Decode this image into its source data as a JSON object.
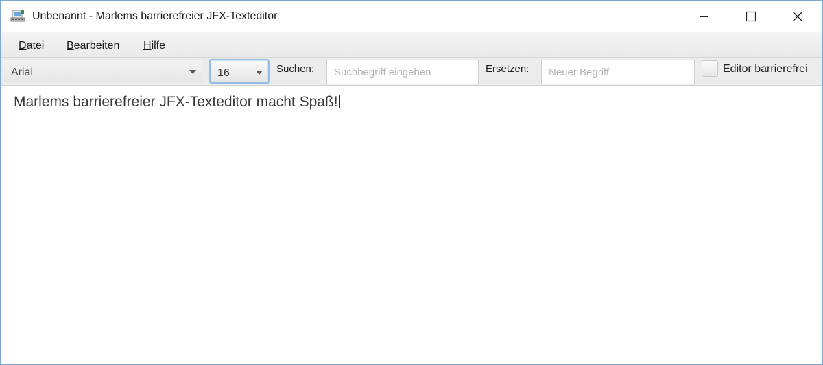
{
  "window": {
    "title": "Unbenannt - Marlems barrierefreier JFX-Texteditor",
    "border_color": "#7aa7d6"
  },
  "menu": {
    "items": [
      {
        "mnemonic": "D",
        "rest": "atei"
      },
      {
        "mnemonic": "B",
        "rest": "earbeiten"
      },
      {
        "mnemonic": "H",
        "rest": "ilfe"
      }
    ]
  },
  "toolbar": {
    "font_value": "Arial",
    "size_value": "16",
    "search_label_mnemonic": "S",
    "search_label_rest": "uchen:",
    "search_placeholder": "Suchbegriff eingeben",
    "replace_label_pre": "Erse",
    "replace_label_mnemonic": "t",
    "replace_label_post": "zen:",
    "replace_placeholder": "Neuer Begriff",
    "checkbox_label_pre": "Editor ",
    "checkbox_label_mnemonic": "b",
    "checkbox_label_post": "arrierefrei",
    "checkbox_checked": false
  },
  "editor": {
    "content": "Marlems barrierefreier JFX-Texteditor macht Spaß!"
  },
  "icons": {
    "app": "app-icon",
    "minimize": "minimize-icon",
    "maximize": "maximize-icon",
    "close": "close-icon",
    "dropdown": "chevron-down-icon"
  }
}
